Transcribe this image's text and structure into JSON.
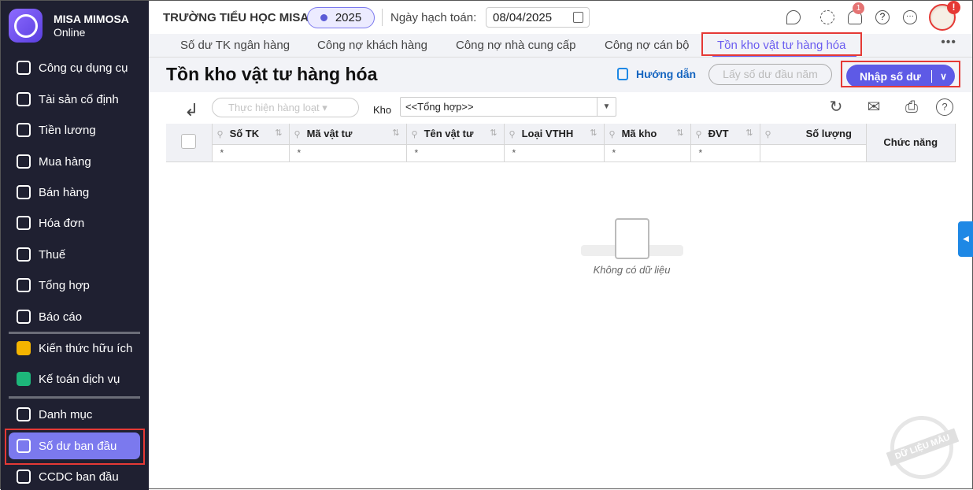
{
  "brand": {
    "name": "MISA MIMOSA",
    "sub": "Online"
  },
  "sidebar": {
    "items": [
      {
        "label": "Công cụ dụng cụ"
      },
      {
        "label": "Tài sản cố định"
      },
      {
        "label": "Tiền lương"
      },
      {
        "label": "Mua hàng"
      },
      {
        "label": "Bán hàng"
      },
      {
        "label": "Hóa đơn"
      },
      {
        "label": "Thuế"
      },
      {
        "label": "Tổng hợp"
      },
      {
        "label": "Báo cáo"
      },
      {
        "label": "Kiến thức hữu ích"
      },
      {
        "label": "Kế toán dịch vụ"
      },
      {
        "label": "Danh mục"
      },
      {
        "label": "Số dư ban đầu",
        "active": true
      },
      {
        "label": "CCDC ban đầu"
      }
    ]
  },
  "header": {
    "school": "TRƯỜNG TIỂU HỌC MISA",
    "year": "2025",
    "date_label": "Ngày hạch toán:",
    "date": "08/04/2025",
    "notification_count": "1",
    "avatar_alert": "!"
  },
  "tabs": [
    {
      "label": "Số dư TK ngân hàng"
    },
    {
      "label": "Công nợ khách hàng"
    },
    {
      "label": "Công nợ nhà cung cấp"
    },
    {
      "label": "Công nợ cán bộ"
    },
    {
      "label": "Tồn kho vật tư hàng hóa",
      "active": true
    }
  ],
  "page": {
    "title": "Tồn kho vật tư hàng hóa",
    "guide": "Hướng dẫn",
    "get_balance": "Lấy số dư đầu năm",
    "enter_balance": "Nhập số dư"
  },
  "toolbar": {
    "batch": "Thực hiện hàng loạt",
    "kho_label": "Kho",
    "kho_value": "<<Tổng hợp>>"
  },
  "table": {
    "columns": [
      "Số TK",
      "Mã vật tư",
      "Tên vật tư",
      "Loại VTHH",
      "Mã kho",
      "ĐVT",
      "Số lượng",
      "Chức năng"
    ],
    "filter_marker": "*"
  },
  "empty": "Không có dữ liệu",
  "watermark": "DỮ LIỆU MẪU"
}
